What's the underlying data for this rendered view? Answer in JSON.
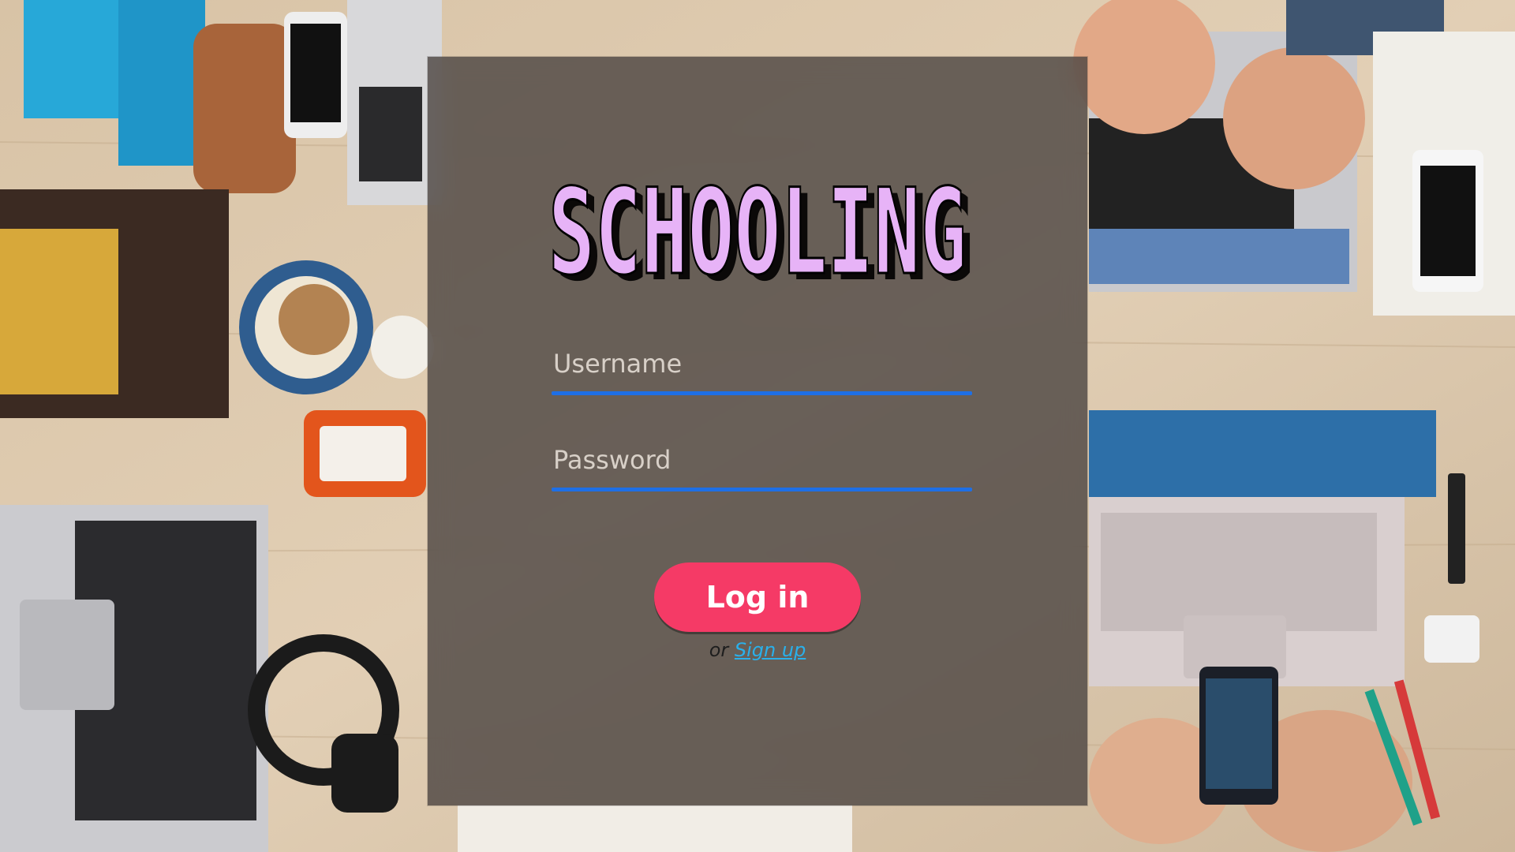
{
  "app": {
    "title": "SCHOOLING"
  },
  "login_form": {
    "username": {
      "placeholder": "Username",
      "value": ""
    },
    "password": {
      "placeholder": "Password",
      "value": ""
    },
    "login_button": "Log in",
    "signup_prefix": "or",
    "signup_link": "Sign up"
  },
  "colors": {
    "accent_button": "#f53a66",
    "field_underline": "#1e6fe6",
    "logo_fill": "#e7b3f7",
    "link": "#2ab0ea"
  }
}
